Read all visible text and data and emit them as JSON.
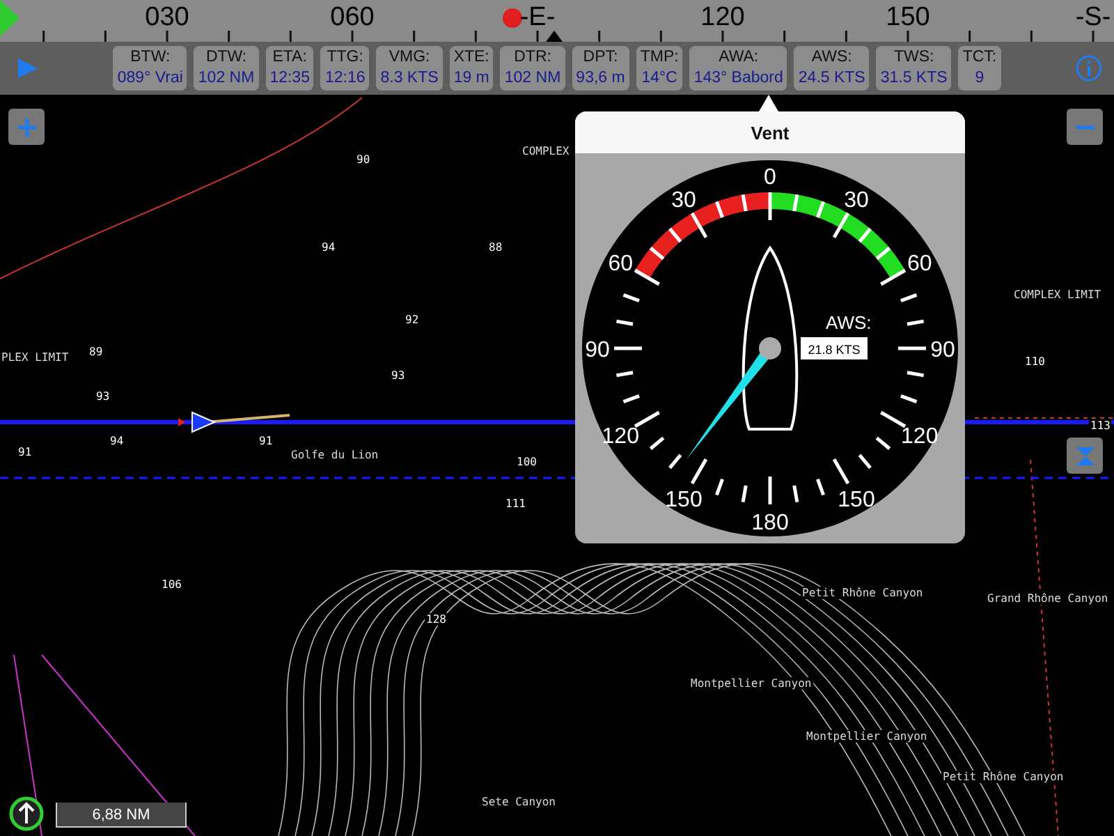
{
  "compass": {
    "labels": [
      "030",
      "060",
      "-E-",
      "120",
      "150",
      "-S-"
    ]
  },
  "instruments": [
    {
      "label": "BTW:",
      "value": "089° Vrai"
    },
    {
      "label": "DTW:",
      "value": "102 NM"
    },
    {
      "label": "ETA:",
      "value": "12:35"
    },
    {
      "label": "TTG:",
      "value": "12:16"
    },
    {
      "label": "VMG:",
      "value": "8.3 KTS"
    },
    {
      "label": "XTE:",
      "value": "19 m"
    },
    {
      "label": "DTR:",
      "value": "102 NM"
    },
    {
      "label": "DPT:",
      "value": "93,6 m"
    },
    {
      "label": "TMP:",
      "value": "14°C"
    },
    {
      "label": "AWA:",
      "value": "143° Babord"
    },
    {
      "label": "AWS:",
      "value": "24.5 KTS"
    },
    {
      "label": "TWS:",
      "value": "31.5 KTS"
    },
    {
      "label": "TCT:",
      "value": "9"
    }
  ],
  "map": {
    "labels": [
      "COMPLEX",
      "COMPLEX LIMIT",
      "PLEX LIMIT",
      "Golfe du Lion",
      "Petit Rhône Canyon",
      "Grand Rhône Canyon",
      "Montpellier Canyon",
      "Montpellier Canyon",
      "Petit Rhône Canyon",
      "Sete Canyon"
    ],
    "soundings": [
      "90",
      "94",
      "88",
      "92",
      "89",
      "93",
      "93",
      "91",
      "94",
      "91",
      "100",
      "111",
      "106",
      "128",
      "110",
      "113"
    ]
  },
  "popup": {
    "title": "Vent",
    "gauge": {
      "scale_labels": [
        "0",
        "30",
        "60",
        "90",
        "120",
        "150",
        "180",
        "150",
        "120",
        "90",
        "60",
        "30"
      ],
      "aws_label": "AWS:",
      "aws_value": "21.8 KTS"
    }
  },
  "scale_bar": {
    "distance": "6,88 NM"
  }
}
